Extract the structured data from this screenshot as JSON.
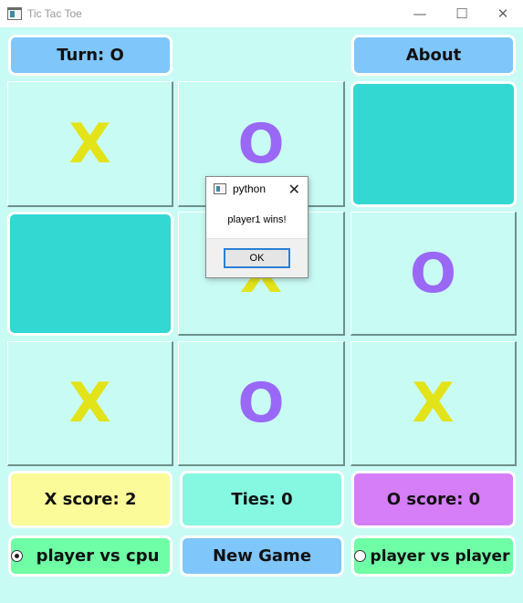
{
  "window": {
    "title": "Tic Tac Toe",
    "minimize": "—",
    "maximize": "☐",
    "close": "✕"
  },
  "header": {
    "turn": "Turn: O",
    "about": "About"
  },
  "board": {
    "cells": [
      "X",
      "O",
      "",
      "",
      "X",
      "O",
      "X",
      "O",
      "X"
    ]
  },
  "scores": {
    "x": "X score: 2",
    "ties": "Ties: 0",
    "o": "O score: 0"
  },
  "controls": {
    "mode_cpu": "player vs cpu",
    "new_game": "New Game",
    "mode_pvp": "player vs player",
    "selected_mode": "player vs cpu"
  },
  "dialog": {
    "title": "python",
    "message": "player1 wins!",
    "ok": "OK"
  },
  "colors": {
    "background": "#c9fbf5",
    "x_mark": "#e3e31a",
    "o_mark": "#9a68f7",
    "filled_cell": "#33d8d2"
  }
}
